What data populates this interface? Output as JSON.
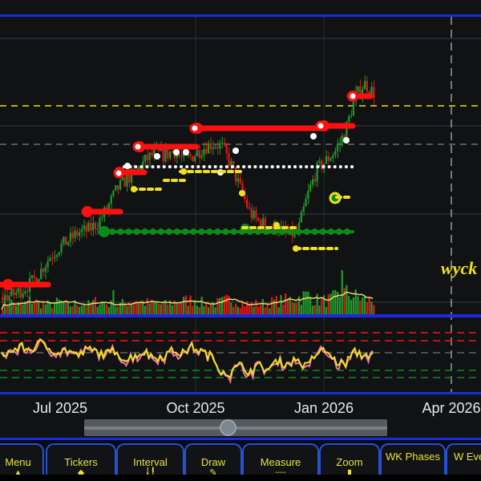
{
  "x_axis": {
    "labels": [
      {
        "text": "Jul 2025"
      },
      {
        "text": "Oct 2025"
      },
      {
        "text": "Jan 2026"
      },
      {
        "text": "Apr 2026"
      }
    ]
  },
  "watermark": "wyck",
  "slider": {
    "position": 0.45
  },
  "toolbar": {
    "buttons": [
      {
        "label": "Menu",
        "icon": "up-arrow-icon"
      },
      {
        "label": "Tickers",
        "icon": "chevron-icon"
      },
      {
        "label": "Interval",
        "icon": "candles-icon"
      },
      {
        "label": "Draw",
        "icon": "pencil-icon"
      },
      {
        "label": "Measure",
        "icon": "ruler-icon"
      },
      {
        "label": "Zoom",
        "icon": "zoom-icon"
      },
      {
        "label": "WK Phases",
        "icon": ""
      },
      {
        "label": "W Eve",
        "icon": ""
      }
    ]
  },
  "colors": {
    "up": "#1f9a2a",
    "down": "#e01a1a",
    "resistance": "#ff1010",
    "support": "#0f8a1a",
    "accent": "#1a2be0",
    "text": "#e6e23a"
  },
  "chart_data": {
    "type": "candlestick",
    "price_anchors": [
      3,
      4,
      6,
      9,
      14,
      20,
      24,
      27,
      30,
      31,
      34,
      40,
      48,
      52,
      55,
      60,
      63,
      62,
      64,
      60,
      62,
      65,
      67,
      66,
      58,
      48,
      38,
      34,
      33,
      32,
      29,
      30,
      45,
      56,
      60,
      64,
      72,
      86,
      92,
      88
    ],
    "rsi_anchors": [
      58,
      60,
      66,
      62,
      70,
      64,
      60,
      62,
      55,
      63,
      60,
      57,
      62,
      50,
      56,
      60,
      54,
      55,
      62,
      58,
      66,
      60,
      55,
      40,
      35,
      45,
      38,
      44,
      40,
      50,
      46,
      52,
      42,
      58,
      62,
      50,
      45,
      60,
      56,
      58
    ],
    "volume_anchors": [
      20,
      25,
      18,
      30,
      22,
      20,
      26,
      18,
      24,
      20,
      28,
      22,
      18,
      25,
      30,
      24,
      22,
      20,
      26,
      28,
      30,
      24,
      22,
      25,
      32,
      26,
      20,
      22,
      24,
      28,
      30,
      34,
      40,
      30,
      28,
      35,
      45,
      38,
      30,
      28
    ]
  }
}
